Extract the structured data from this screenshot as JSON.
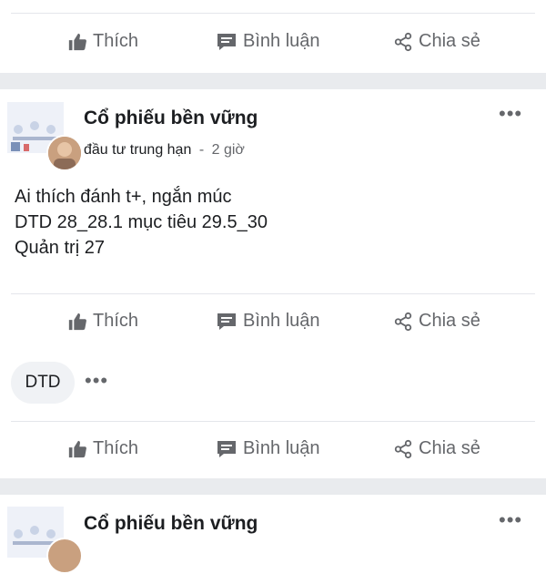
{
  "actions": {
    "like": "Thích",
    "comment": "Bình luận",
    "share": "Chia sẻ"
  },
  "post1": {
    "group_name": "Cổ phiếu bền vững",
    "author": "đầu tư trung hạn",
    "separator": "-",
    "time": "2 giờ",
    "lines": "Ai thích đánh t+, ngắn múc\nDTD 28_28.1 mục tiêu 29.5_30\nQuản trị 27",
    "tag": "DTD"
  },
  "post2": {
    "group_name": "Cổ phiếu bền vững"
  },
  "icons": {
    "like": "thumbs-up-icon",
    "comment": "comment-icon",
    "share": "share-icon",
    "more": "more-options-icon"
  },
  "colors": {
    "text": "#1c1e21",
    "muted": "#65676b",
    "divider": "#e4e6eb",
    "separator": "#e9ebee"
  }
}
